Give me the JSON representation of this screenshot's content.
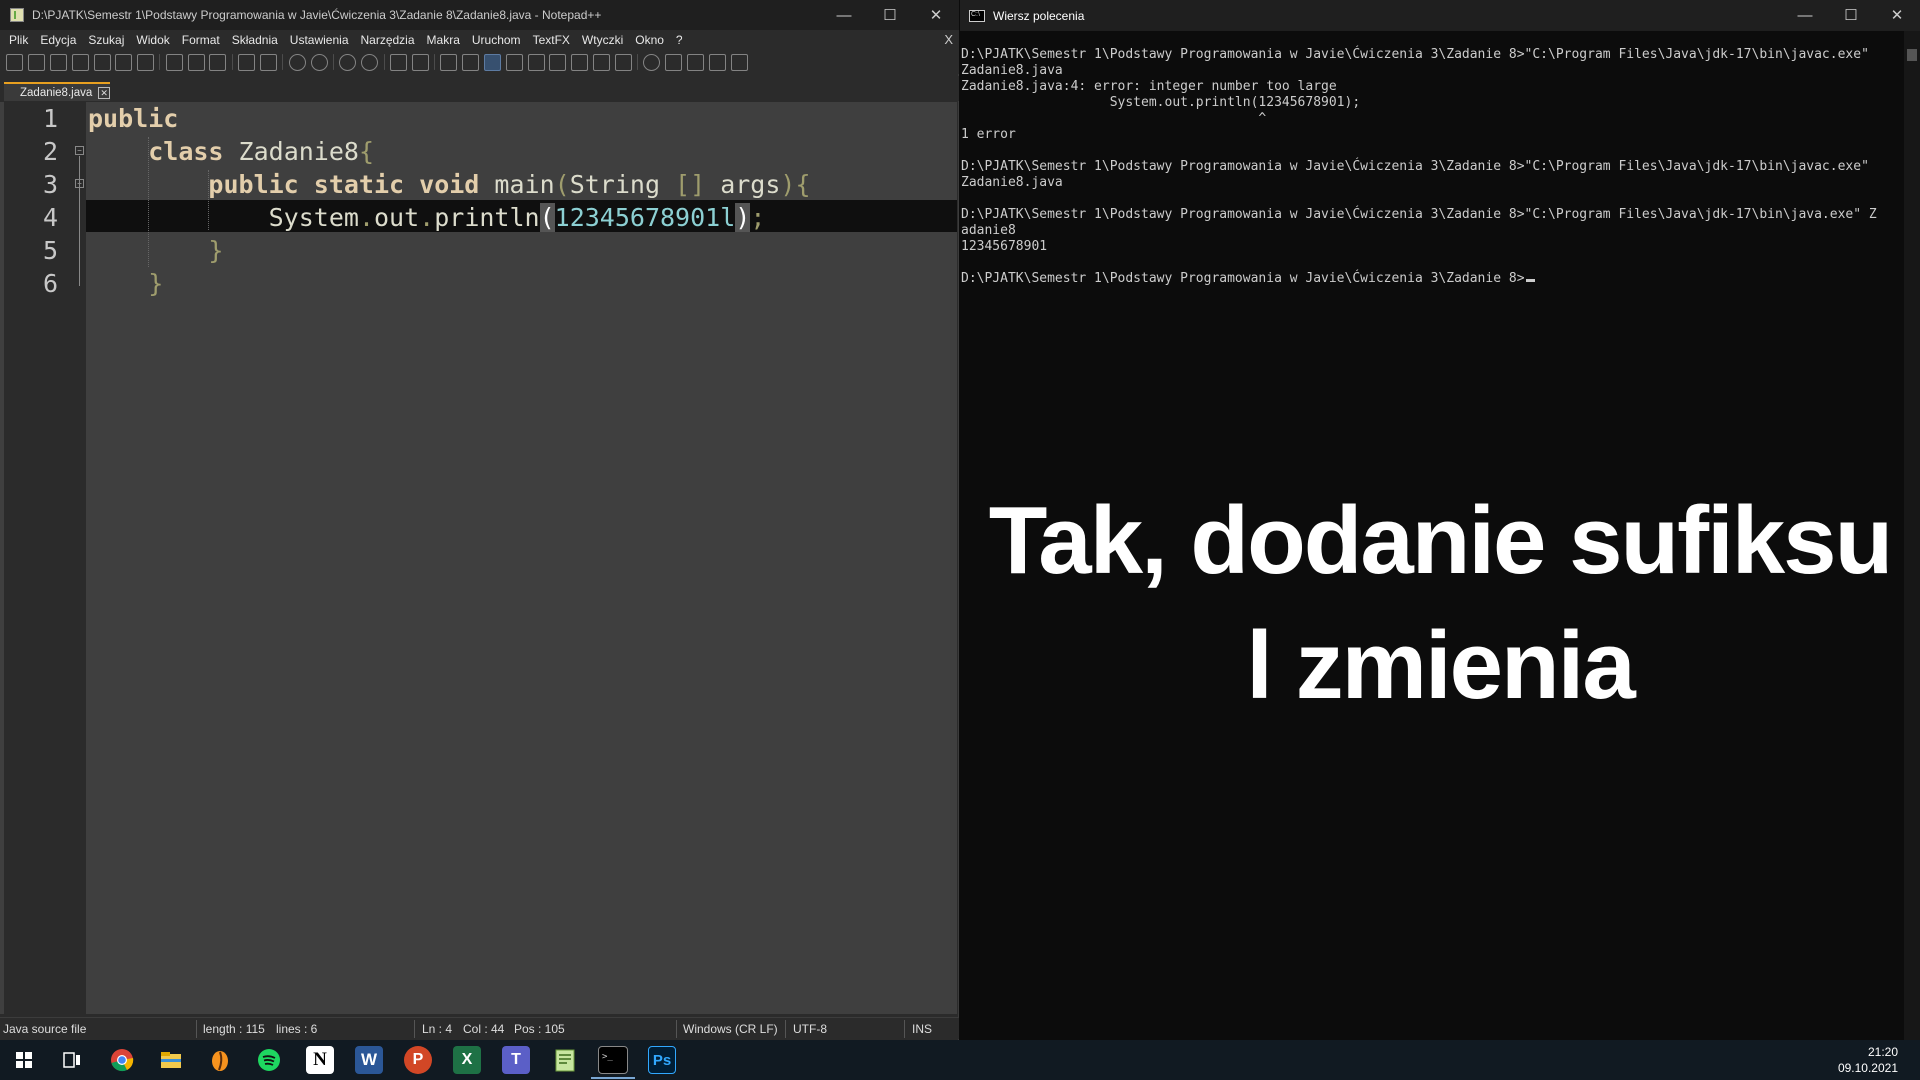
{
  "npp": {
    "title": "D:\\PJATK\\Semestr 1\\Podstawy Programowania w Javie\\Ćwiczenia 3\\Zadanie 8\\Zadanie8.java - Notepad++",
    "menu": [
      "Plik",
      "Edycja",
      "Szukaj",
      "Widok",
      "Format",
      "Składnia",
      "Ustawienia",
      "Narzędzia",
      "Makra",
      "Uruchom",
      "TextFX",
      "Wtyczki",
      "Okno",
      "?"
    ],
    "menu_close": "X",
    "tab_label": "Zadanie8.java",
    "line_numbers": [
      "1",
      "2",
      "3",
      "4",
      "5",
      "6"
    ],
    "code": {
      "l1_kw": "public",
      "l2_kw": "class",
      "l2_name": " Zadanie8",
      "l2_br": "{",
      "l3_kw": "public static void",
      "l3_name": " main",
      "l3_paren": "(",
      "l3_type": "String ",
      "l3_arr": "[]",
      "l3_arg": " args",
      "l3_close": "){",
      "l4_a": "System",
      "l4_dot1": ".",
      "l4_b": "out",
      "l4_dot2": ".",
      "l4_c": "println",
      "l4_open": "(",
      "l4_num": "12345678901l",
      "l4_close": ")",
      "l4_semi": ";",
      "l5": "}",
      "l6": "}"
    },
    "status": {
      "type": "Java source file",
      "length": "length : 115",
      "lines": "lines : 6",
      "ln": "Ln : 4",
      "col": "Col : 44",
      "pos": "Pos : 105",
      "eol": "Windows (CR LF)",
      "enc": "UTF-8",
      "mode": "INS"
    }
  },
  "cmd": {
    "title": "Wiersz polecenia",
    "lines": [
      "D:\\PJATK\\Semestr 1\\Podstawy Programowania w Javie\\Ćwiczenia 3\\Zadanie 8>\"C:\\Program Files\\Java\\jdk-17\\bin\\javac.exe\"",
      "Zadanie8.java",
      "Zadanie8.java:4: error: integer number too large",
      "                   System.out.println(12345678901);",
      "                                      ^",
      "1 error",
      "",
      "D:\\PJATK\\Semestr 1\\Podstawy Programowania w Javie\\Ćwiczenia 3\\Zadanie 8>\"C:\\Program Files\\Java\\jdk-17\\bin\\javac.exe\"",
      "Zadanie8.java",
      "",
      "D:\\PJATK\\Semestr 1\\Podstawy Programowania w Javie\\Ćwiczenia 3\\Zadanie 8>\"C:\\Program Files\\Java\\jdk-17\\bin\\java.exe\" Z",
      "adanie8",
      "12345678901",
      "",
      "D:\\PJATK\\Semestr 1\\Podstawy Programowania w Javie\\Ćwiczenia 3\\Zadanie 8>"
    ],
    "overlay_line1": "Tak, dodanie sufiksu",
    "overlay_line2": "l zmienia"
  },
  "window_buttons": {
    "min": "—",
    "max": "☐",
    "close": "✕"
  },
  "taskbar": {
    "icons": [
      "windows-start",
      "task-view",
      "chrome",
      "file-explorer",
      "fl-studio",
      "spotify",
      "notion",
      "word",
      "powerpoint",
      "excel",
      "teams",
      "notepad-plus-plus",
      "command-prompt",
      "photoshop"
    ],
    "notion_label": "N",
    "word_label": "W",
    "ppt_label": "P",
    "excel_label": "X",
    "teams_label": "T",
    "ps_label": "Ps",
    "time": "21:20",
    "date": "09.10.2021"
  }
}
